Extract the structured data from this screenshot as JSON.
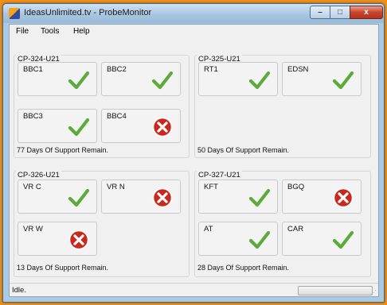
{
  "window": {
    "title": "IdeasUnlimited.tv - ProbeMonitor",
    "controls": {
      "minimize": "–",
      "maximize": "□",
      "close": "x"
    }
  },
  "menu": [
    "File",
    "Tools",
    "Help"
  ],
  "groups": [
    {
      "title": "CP-324-U21",
      "support": "77 Days Of Support Remain.",
      "probes": [
        {
          "name": "BBC1",
          "status": "ok"
        },
        {
          "name": "BBC2",
          "status": "ok"
        },
        {
          "name": "BBC3",
          "status": "ok"
        },
        {
          "name": "BBC4",
          "status": "error"
        }
      ]
    },
    {
      "title": "CP-325-U21",
      "support": "50 Days Of Support Remain.",
      "probes": [
        {
          "name": "RT1",
          "status": "ok"
        },
        {
          "name": "EDSN",
          "status": "ok"
        }
      ]
    },
    {
      "title": "CP-326-U21",
      "support": "13 Days Of Support Remain.",
      "probes": [
        {
          "name": "VR C",
          "status": "ok"
        },
        {
          "name": "VR N",
          "status": "error"
        },
        {
          "name": "VR W",
          "status": "error"
        }
      ]
    },
    {
      "title": "CP-327-U21",
      "support": "28 Days Of Support Remain.",
      "probes": [
        {
          "name": "KFT",
          "status": "ok"
        },
        {
          "name": "BGQ",
          "status": "error"
        },
        {
          "name": "AT",
          "status": "ok"
        },
        {
          "name": "CAR",
          "status": "ok"
        }
      ]
    }
  ],
  "status_bar": {
    "text": "Idle.",
    "progress_fraction": 0
  },
  "icons": {
    "ok": "green-check-icon",
    "error": "red-x-circle-icon"
  },
  "colors": {
    "ok": "#5cab3a",
    "error": "#c8291f"
  }
}
